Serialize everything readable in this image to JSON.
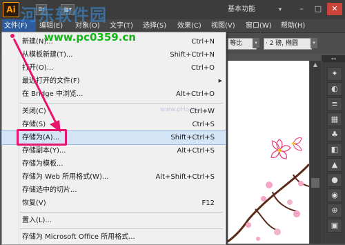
{
  "app": {
    "logo": "Ai",
    "workspace_label": "基本功能",
    "workspace_caret": "▾",
    "window_buttons": [
      "–",
      "□",
      "✕"
    ]
  },
  "watermark": {
    "site_name": "河东软件园",
    "url": "www.pc0359.cn",
    "faint_url": "www.pHome..."
  },
  "menubar": {
    "items": [
      {
        "label": "文件(F)",
        "active": true
      },
      {
        "label": "编辑(E)",
        "active": false
      },
      {
        "label": "对象(O)",
        "active": false
      },
      {
        "label": "文字(T)",
        "active": false
      },
      {
        "label": "选择(S)",
        "active": false
      },
      {
        "label": "效果(C)",
        "active": false
      },
      {
        "label": "视图(V)",
        "active": false
      },
      {
        "label": "窗口(W)",
        "active": false
      },
      {
        "label": "帮助(H)",
        "active": false
      }
    ]
  },
  "controlbar": {
    "ratio_field": "等比",
    "stroke_field": "· 2 磅, 椭圆",
    "dropdown_glyph": "▾"
  },
  "file_menu": {
    "items": [
      {
        "label": "新建(N)...",
        "shortcut": "Ctrl+N"
      },
      {
        "label": "从模板新建(T)...",
        "shortcut": "Shift+Ctrl+N"
      },
      {
        "label": "打开(O)...",
        "shortcut": "Ctrl+O"
      },
      {
        "label": "最近打开的文件(F)",
        "shortcut": "",
        "submenu": "▶"
      },
      {
        "label": "在 Bridge 中浏览...",
        "shortcut": "Alt+Ctrl+O"
      },
      {
        "label": "关闭(C)",
        "shortcut": "Ctrl+W"
      },
      {
        "label": "存储(S)",
        "shortcut": "Ctrl+S"
      },
      {
        "label": "存储为(A)...",
        "shortcut": "Shift+Ctrl+S",
        "highlighted": true
      },
      {
        "label": "存储副本(Y)...",
        "shortcut": "Alt+Ctrl+S"
      },
      {
        "label": "存储为模板...",
        "shortcut": ""
      },
      {
        "label": "存储为 Web 所用格式(W)...",
        "shortcut": "Alt+Shift+Ctrl+S"
      },
      {
        "label": "存储选中的切片...",
        "shortcut": ""
      },
      {
        "label": "恢复(V)",
        "shortcut": "F12"
      },
      {
        "label": "置入(L)...",
        "shortcut": ""
      },
      {
        "label": "存储为 Microsoft Office 所用格式...",
        "shortcut": ""
      }
    ]
  },
  "dock": {
    "collapse_glyph": "◂◂",
    "icons": [
      "✦",
      "◐",
      "≡",
      "▦",
      "♣",
      "◧",
      "▲",
      "●",
      "◉",
      "⊕",
      "▣"
    ]
  },
  "scroll": {
    "up": "▲",
    "down": "▼"
  },
  "colors": {
    "highlight_border": "#e6156b",
    "arrow": "#e6156b",
    "menu_active": "#2d5d9e",
    "logo_orange": "#ff9a00",
    "blossom": "#e8347a"
  }
}
